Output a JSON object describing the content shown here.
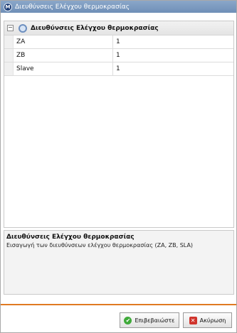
{
  "window": {
    "title": "Διευθύνσεις Ελέγχου θερμοκρασίας"
  },
  "grid": {
    "category_label": "Διευθύνσεις Ελέγχου θερμοκρασίας",
    "rows": [
      {
        "name": "ZA",
        "value": "1"
      },
      {
        "name": "ZB",
        "value": "1"
      },
      {
        "name": "Slave",
        "value": "1"
      }
    ]
  },
  "description": {
    "title": "Διευθύνσεις Ελέγχου θερμοκρασίας",
    "text": "Εισαγωγή των διευθύνσεων ελέγχου θερμοκρασίας (ZA, ZB, SLA)"
  },
  "buttons": {
    "ok_label": "Επιβεβαιώστε",
    "cancel_label": "Ακύρωση"
  },
  "icons": [
    "app-icon",
    "collapse-icon",
    "gear-icon",
    "check-icon",
    "x-icon"
  ],
  "colors": {
    "title_bar": "#6f8fb7",
    "accent_line": "#e07a22",
    "ok_icon": "#3faa3a",
    "cancel_icon": "#d0342c"
  }
}
